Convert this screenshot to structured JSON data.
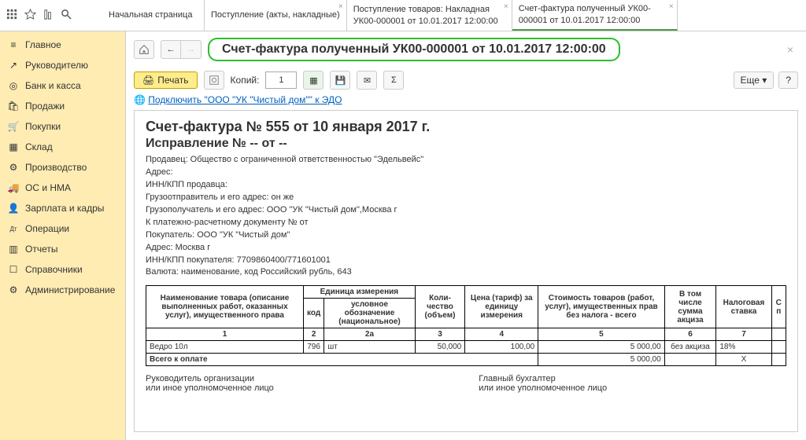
{
  "topbar": {
    "tabs": [
      {
        "label": "Начальная страница"
      },
      {
        "label": "Поступление (акты, накладные)"
      },
      {
        "label": "Поступление товаров: Накладная УК00-000001 от 10.01.2017 12:00:00"
      },
      {
        "label": "Счет-фактура полученный УК00-000001 от 10.01.2017 12:00:00"
      }
    ]
  },
  "sidebar": {
    "items": [
      {
        "label": "Главное",
        "icon": "≡"
      },
      {
        "label": "Руководителю",
        "icon": "↗"
      },
      {
        "label": "Банк и касса",
        "icon": "◎"
      },
      {
        "label": "Продажи",
        "icon": "🛍"
      },
      {
        "label": "Покупки",
        "icon": "🛒"
      },
      {
        "label": "Склад",
        "icon": "▦"
      },
      {
        "label": "Производство",
        "icon": "⚙"
      },
      {
        "label": "ОС и НМА",
        "icon": "🚚"
      },
      {
        "label": "Зарплата и кадры",
        "icon": "👤"
      },
      {
        "label": "Операции",
        "icon": "Дт"
      },
      {
        "label": "Отчеты",
        "icon": "▥"
      },
      {
        "label": "Справочники",
        "icon": "☐"
      },
      {
        "label": "Администрирование",
        "icon": "⚙"
      }
    ]
  },
  "header": {
    "title": "Счет-фактура полученный УК00-000001 от 10.01.2017 12:00:00"
  },
  "toolbar": {
    "print": "Печать",
    "copies_label": "Копий:",
    "copies_value": "1",
    "more": "Еще",
    "help": "?"
  },
  "edo": {
    "icon": "🌐",
    "link": "Подключить \"ООО \"УК \"Чистый дом\"\" к ЭДО"
  },
  "doc": {
    "h1": "Счет-фактура № 555 от 10 января 2017 г.",
    "h2": "Исправление № -- от --",
    "meta": [
      "Продавец: Общество с ограниченной ответственностью \"Эдельвейс\"",
      "Адрес:",
      "ИНН/КПП продавца:",
      "Грузоотправитель и его адрес: он же",
      "Грузополучатель и его адрес: ООО \"УК \"Чистый дом\",Москва г",
      "К платежно-расчетному документу №    от",
      "Покупатель: ООО \"УК \"Чистый дом\"",
      "Адрес: Москва г",
      "ИНН/КПП покупателя: 7709860400/771601001",
      "Валюта: наименование, код Российский рубль, 643"
    ],
    "thead": {
      "name": "Наименование товара (описание выполненных работ, оказанных услуг), имущественного права",
      "unit": "Единица измерения",
      "code": "код",
      "symbol": "условное обозначение (национальное)",
      "qty": "Коли-чество (объем)",
      "price": "Цена (тариф) за единицу измерения",
      "cost": "Стоимость товаров (работ, услуг), имущественных прав без налога - всего",
      "excise": "В том числе сумма акциза",
      "rate": "Налоговая ставка",
      "last": "С п"
    },
    "cols": [
      "1",
      "2",
      "2а",
      "3",
      "4",
      "5",
      "6",
      "7"
    ],
    "row": {
      "name": "Ведро 10л",
      "code": "796",
      "symbol": "шт",
      "qty": "50,000",
      "price": "100,00",
      "cost": "5 000,00",
      "excise": "без акциза",
      "rate": "18%"
    },
    "total_label": "Всего к оплате",
    "total_cost": "5 000,00",
    "total_excise": "X",
    "sign_left1": "Руководитель организации",
    "sign_left2": "или иное уполномоченное лицо",
    "sign_right1": "Главный бухгалтер",
    "sign_right2": "или иное уполномоченное лицо"
  }
}
